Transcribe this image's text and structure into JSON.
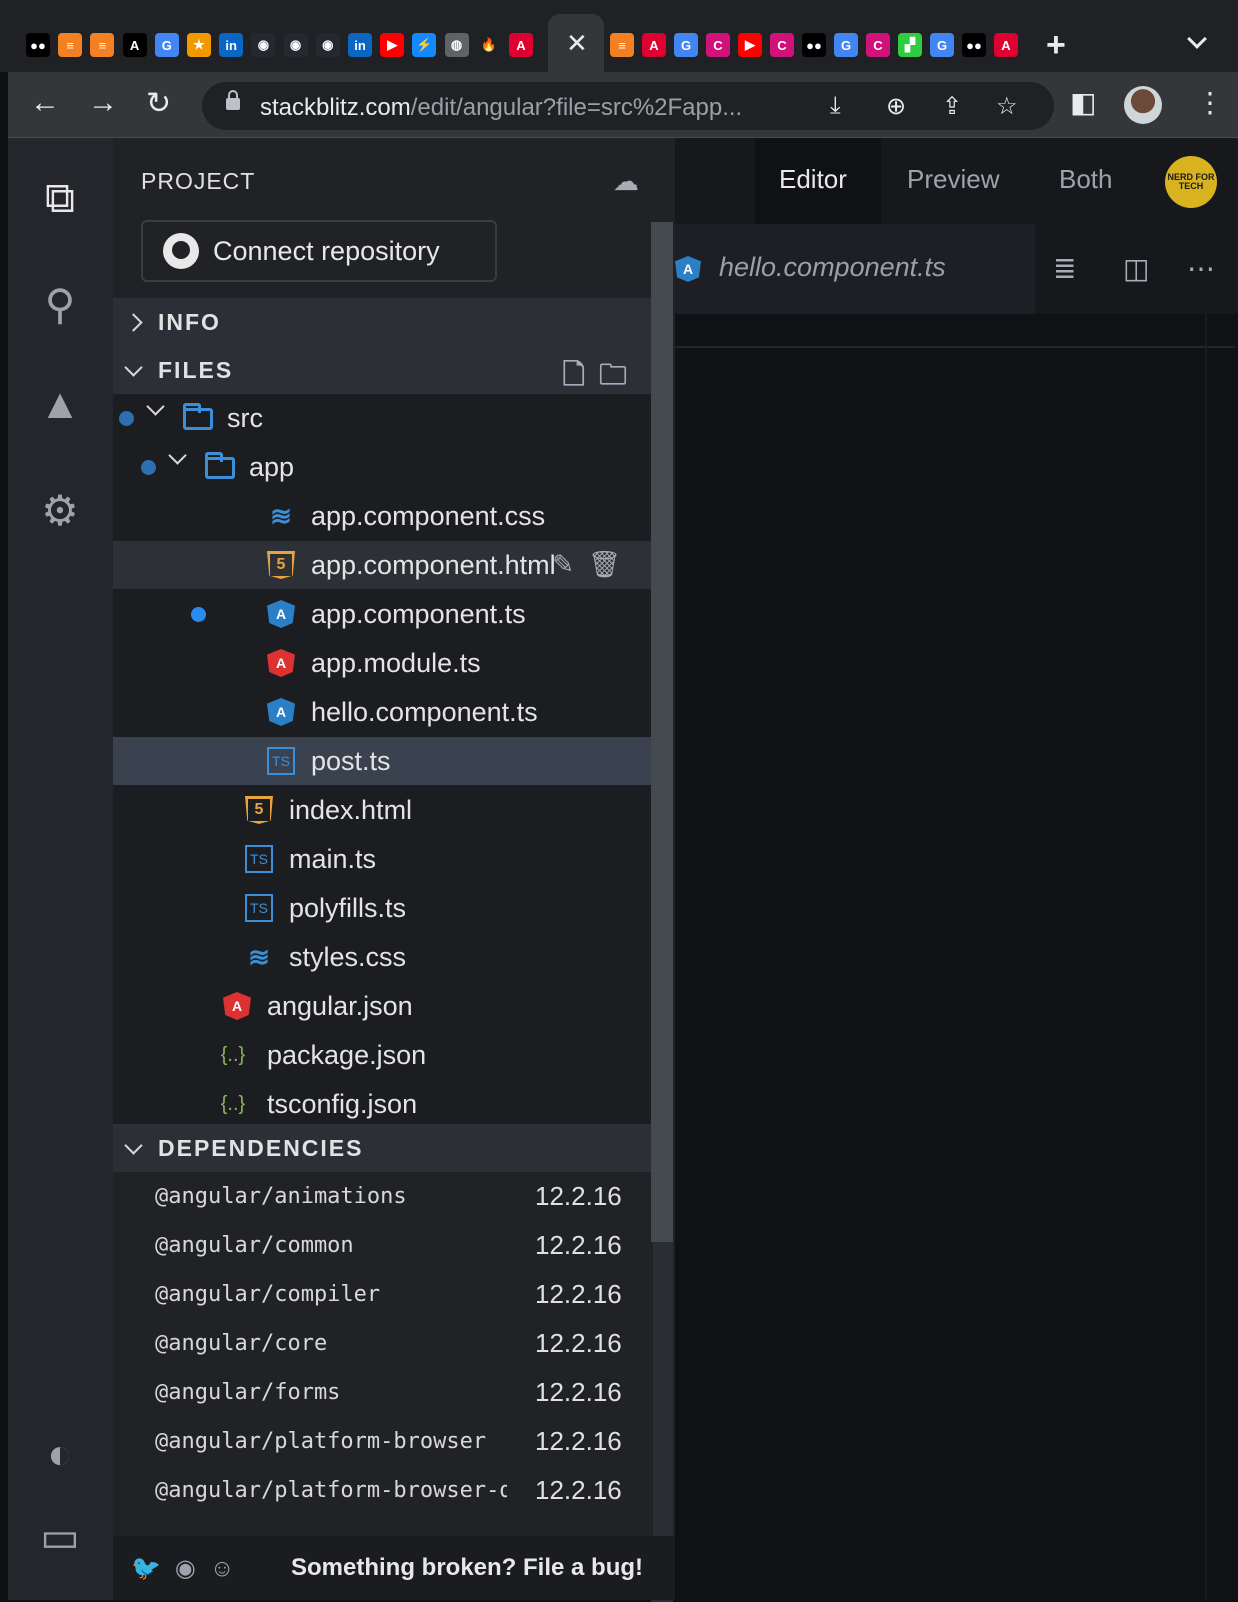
{
  "browser": {
    "tabs": [
      {
        "icon": "medium-icon",
        "glyph": "●●",
        "color": "#000000"
      },
      {
        "icon": "stackoverflow-icon",
        "glyph": "≡",
        "color": "#f48024"
      },
      {
        "icon": "stackoverflow-icon",
        "glyph": "≡",
        "color": "#f48024"
      },
      {
        "icon": "letter-a-icon",
        "glyph": "A",
        "color": "#000000"
      },
      {
        "icon": "google-icon",
        "glyph": "G",
        "color": "#4285f4"
      },
      {
        "icon": "star-icon",
        "glyph": "★",
        "color": "#f29900"
      },
      {
        "icon": "linkedin-icon",
        "glyph": "in",
        "color": "#0a66c2"
      },
      {
        "icon": "github-icon",
        "glyph": "◉",
        "color": "#24292f"
      },
      {
        "icon": "github-icon",
        "glyph": "◉",
        "color": "#24292f"
      },
      {
        "icon": "github-icon",
        "glyph": "◉",
        "color": "#24292f"
      },
      {
        "icon": "linkedin-icon",
        "glyph": "in",
        "color": "#0a66c2"
      },
      {
        "icon": "youtube-icon",
        "glyph": "▶",
        "color": "#ff0000"
      },
      {
        "icon": "bolt-icon",
        "glyph": "⚡",
        "color": "#1389fd"
      },
      {
        "icon": "globe-icon",
        "glyph": "◍",
        "color": "#5f6368"
      },
      {
        "icon": "fire-icon",
        "glyph": "🔥",
        "color": "#202124"
      },
      {
        "icon": "angular-icon",
        "glyph": "A",
        "color": "#dd0031"
      }
    ],
    "tabs_right": [
      {
        "icon": "stackoverflow-icon",
        "glyph": "≡",
        "color": "#f48024"
      },
      {
        "icon": "angular-icon",
        "glyph": "A",
        "color": "#dd0031"
      },
      {
        "icon": "google-icon",
        "glyph": "G",
        "color": "#4285f4"
      },
      {
        "icon": "c-icon",
        "glyph": "C",
        "color": "#d1127a"
      },
      {
        "icon": "youtube-icon",
        "glyph": "▶",
        "color": "#ff0000"
      },
      {
        "icon": "c-icon",
        "glyph": "C",
        "color": "#d1127a"
      },
      {
        "icon": "medium-icon",
        "glyph": "●●",
        "color": "#000000"
      },
      {
        "icon": "google-icon",
        "glyph": "G",
        "color": "#4285f4"
      },
      {
        "icon": "c-icon",
        "glyph": "C",
        "color": "#d1127a"
      },
      {
        "icon": "stairs-icon",
        "glyph": "▞",
        "color": "#2ecc40"
      },
      {
        "icon": "google-icon",
        "glyph": "G",
        "color": "#4285f4"
      },
      {
        "icon": "medium-icon",
        "glyph": "●●",
        "color": "#000000"
      },
      {
        "icon": "angular-icon",
        "glyph": "A",
        "color": "#dd0031"
      }
    ],
    "url_host": "stackblitz.com",
    "url_path": "/edit/angular?file=src%2Fapp..."
  },
  "sidebar": {
    "project_title": "PROJECT",
    "connect_label": "Connect repository",
    "info_label": "INFO",
    "files_label": "FILES",
    "dependencies_label": "DEPENDENCIES",
    "tree": [
      {
        "name": "src",
        "kind": "folder"
      },
      {
        "name": "app",
        "kind": "folder"
      },
      {
        "name": "app.component.css",
        "kind": "css"
      },
      {
        "name": "app.component.html",
        "kind": "html"
      },
      {
        "name": "app.component.ts",
        "kind": "ng"
      },
      {
        "name": "app.module.ts",
        "kind": "ngred"
      },
      {
        "name": "hello.component.ts",
        "kind": "ng"
      },
      {
        "name": "post.ts",
        "kind": "ts"
      },
      {
        "name": "index.html",
        "kind": "html"
      },
      {
        "name": "main.ts",
        "kind": "ts"
      },
      {
        "name": "polyfills.ts",
        "kind": "ts"
      },
      {
        "name": "styles.css",
        "kind": "css"
      },
      {
        "name": "angular.json",
        "kind": "ngred"
      },
      {
        "name": "package.json",
        "kind": "json"
      },
      {
        "name": "tsconfig.json",
        "kind": "json"
      }
    ],
    "dependencies": [
      {
        "name": "@angular/animations",
        "version": "12.2.16"
      },
      {
        "name": "@angular/common",
        "version": "12.2.16"
      },
      {
        "name": "@angular/compiler",
        "version": "12.2.16"
      },
      {
        "name": "@angular/core",
        "version": "12.2.16"
      },
      {
        "name": "@angular/forms",
        "version": "12.2.16"
      },
      {
        "name": "@angular/platform-browser",
        "version": "12.2.16"
      },
      {
        "name": "@angular/platform-browser-dynamic",
        "version": "12.2.16"
      }
    ],
    "footer_text": "Something broken? File a bug!"
  },
  "editor": {
    "view_tabs": [
      "Editor",
      "Preview",
      "Both"
    ],
    "active_view": "Editor",
    "open_file": "hello.component.ts",
    "avatar_text": "NERD FOR TECH"
  },
  "colors": {
    "folder": "#3b8fd9",
    "angular_blue": "#2b80c5",
    "angular_red": "#dd3232",
    "selected_row": "#3a4250",
    "modified_dot": "#2b8cf0"
  }
}
